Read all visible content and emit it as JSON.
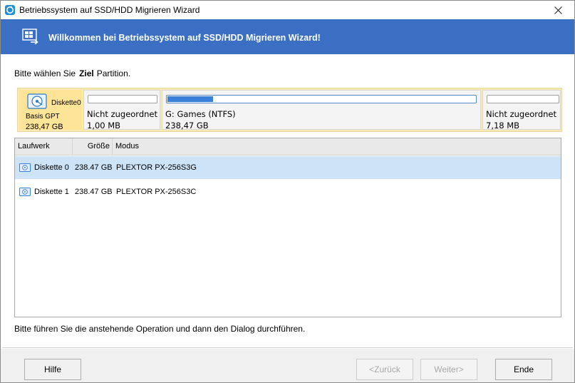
{
  "window": {
    "title": "Betriebssystem auf SSD/HDD Migrieren Wizard"
  },
  "banner": {
    "text": "Willkommen bei Betriebssystem auf SSD/HDD Migrieren Wizard!"
  },
  "prompt": {
    "before": "Bitte wählen Sie",
    "strong": "Ziel",
    "after": "Partition."
  },
  "disk_map": {
    "disk_name": "Diskette0",
    "disk_type": "Basis GPT",
    "disk_size": "238,47 GB",
    "partitions": [
      {
        "label": "Nicht zugeordnet",
        "size": "1,00 MB",
        "used_fraction": 0
      },
      {
        "label": "G: Games (NTFS)",
        "size": "238,47 GB",
        "used_fraction": 0.15
      },
      {
        "label": "Nicht zugeordnet",
        "size": "7,18 MB",
        "used_fraction": 0
      }
    ]
  },
  "table": {
    "columns": [
      "Laufwerk",
      "Größe",
      "Modus"
    ],
    "rows": [
      {
        "drive": "Diskette 0",
        "size": "238.47 GB",
        "model": "PLEXTOR PX-256S3G"
      },
      {
        "drive": "Diskette 1",
        "size": "238.47 GB",
        "model": "PLEXTOR PX-256S3C"
      }
    ]
  },
  "instruction": "Bitte führen Sie die anstehende Operation und dann den Dialog durchführen.",
  "buttons": {
    "help": "Hilfe",
    "back": "<Zurück",
    "next": "Weiter>",
    "finish": "Ende"
  },
  "colors": {
    "banner": "#3a6fc4",
    "selection": "#cce3f8",
    "disk_map_bg": "#fbeab0"
  }
}
